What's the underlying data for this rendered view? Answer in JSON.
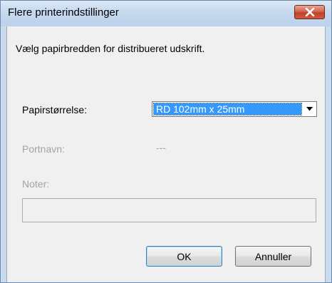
{
  "window": {
    "title": "Flere printerindstillinger"
  },
  "dialog": {
    "instruction": "Vælg papirbredden for distribueret udskrift.",
    "paper_size": {
      "label": "Papirstørrelse:",
      "selected": "RD 102mm x 25mm"
    },
    "port_name": {
      "label": "Portnavn:",
      "value": "---"
    },
    "notes": {
      "label": "Noter:",
      "value": ""
    },
    "ok_label": "OK",
    "cancel_label": "Annuller"
  },
  "colors": {
    "selection": "#3399ff",
    "disabled_text": "#a3a3a3",
    "close_button": "#c2412a"
  },
  "icons": {
    "close": "close-icon",
    "dropdown": "chevron-down-icon"
  }
}
